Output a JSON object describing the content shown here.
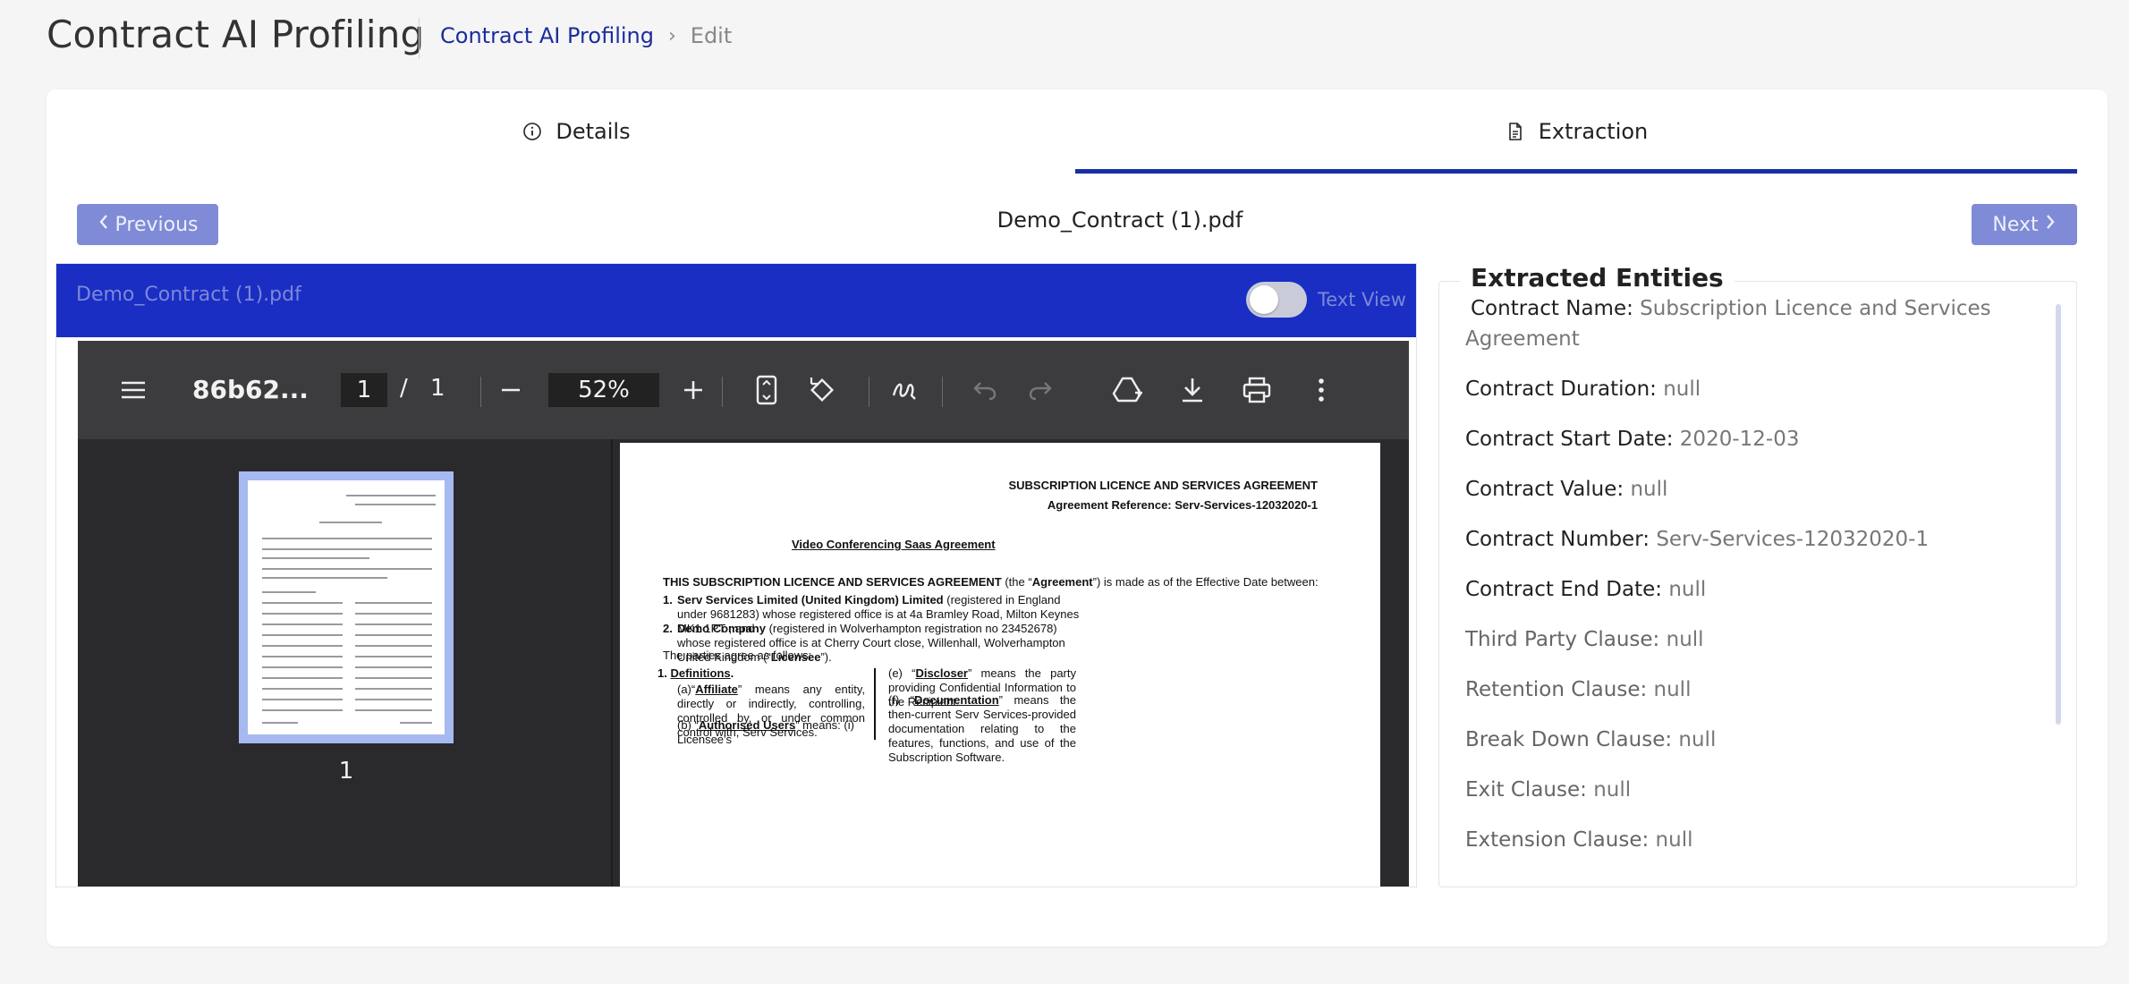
{
  "header": {
    "title": "Contract AI Profiling",
    "breadcrumb": {
      "link": "Contract AI Profiling",
      "separator": "›",
      "current": "Edit"
    }
  },
  "tabs": {
    "details": "Details",
    "extraction": "Extraction",
    "active": "Extraction"
  },
  "nav": {
    "previous": "Previous",
    "next": "Next",
    "file_name": "Demo_Contract (1).pdf"
  },
  "viewer": {
    "header_title": "Demo_Contract (1).pdf",
    "toggle_label": "Text View",
    "toolbar": {
      "file_name": "86b62...",
      "page_input": "1",
      "page_slash": "/",
      "page_total": "1",
      "zoom": "52%"
    },
    "thumbnail_number": "1",
    "document": {
      "title": "SUBSCRIPTION LICENCE AND SERVICES AGREEMENT",
      "reference": "Agreement Reference: Serv-Services-12032020-1",
      "subtitle": "Video Conferencing Saas Agreement",
      "intro_a": "THIS SUBSCRIPTION LICENCE AND SERVICES AGREEMENT",
      "intro_b": " (the “",
      "intro_c": "Agreement",
      "intro_d": "”) is made as of the Effective Date between:",
      "party1_num": "1.",
      "party1_name": "Serv Services Limited (United Kingdom) Limited",
      "party1_rest": " (registered in England under 9681283) whose registered office is at 4a Bramley Road, Milton Keynes MK1 1PT ; and",
      "party2_num": "2.",
      "party2_name": "Demo Company",
      "party2_rest": " (registered in Wolverhampton registration no 23452678) whose registered office is at Cherry Court close, Willenhall, Wolverhampton United Kingdom   (“",
      "party2_role": "Licensee",
      "party2_end": "”).",
      "parties_agree": "The parties agree as follows:",
      "definitions_num": "1.",
      "definitions": "Definitions",
      "definitions_dot": ".",
      "def_a_label": "(a)“",
      "def_a_term": "Affiliate",
      "def_a_text": "” means any entity, directly or indirectly, controlling, controlled by, or under common control with, Serv Services.",
      "def_b_label": "(b)      “",
      "def_b_term": "Authorised Users",
      "def_b_text": "”  means:  (i)  Licensee's",
      "def_e_label": "(e)      “",
      "def_e_term": "Discloser",
      "def_e_text": "”  means  the  party  providing Confidential Information to the Recipient.",
      "def_f_label": "(f)      “",
      "def_f_term": "Documentation",
      "def_f_text": "” means the then-current Serv Services-provided documentation relating to the features, functions, and use of the Subscription Software."
    }
  },
  "entities": {
    "title": "Extracted Entities",
    "items": [
      {
        "key": "Contract Name:",
        "value": "Subscription Licence and Services Agreement"
      },
      {
        "key": "Contract Duration:",
        "value": "null"
      },
      {
        "key": "Contract Start Date:",
        "value": "2020-12-03"
      },
      {
        "key": "Contract Value:",
        "value": "null"
      },
      {
        "key": "Contract Number:",
        "value": "Serv-Services-12032020-1"
      },
      {
        "key": "Contract End Date:",
        "value": "null"
      },
      {
        "key": "Third Party Clause:",
        "value": "null"
      },
      {
        "key": "Retention Clause:",
        "value": "null"
      },
      {
        "key": "Break Down Clause:",
        "value": "null"
      },
      {
        "key": "Exit Clause:",
        "value": "null"
      },
      {
        "key": "Extension Clause:",
        "value": "null"
      }
    ]
  },
  "colors": {
    "accent": "#1a2ea6",
    "viewer_header": "#1a2ec4",
    "button": "#7f8bd6"
  }
}
